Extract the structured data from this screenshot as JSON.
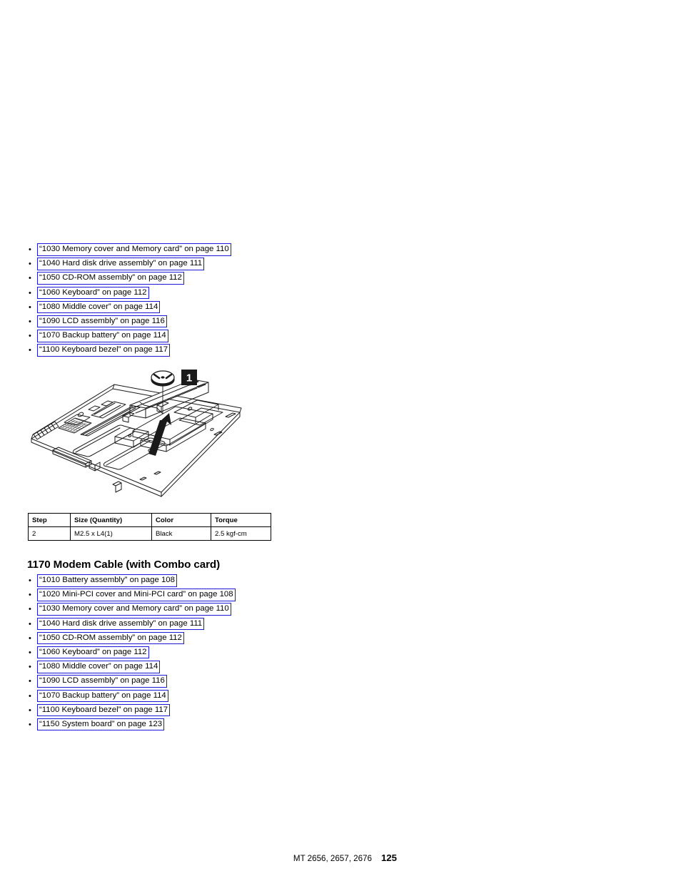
{
  "document": {
    "page_number": "125",
    "footer_machine_types": "MT 2656, 2657, 2676"
  },
  "first_list": {
    "bullet_glyph": "•",
    "items": [
      {
        "label": "“1030 Memory cover and Memory card” on page 110"
      },
      {
        "label": "“1040 Hard disk drive assembly” on page 111"
      },
      {
        "label": "“1050 CD-ROM assembly” on page 112"
      },
      {
        "label": "“1060 Keyboard” on page 112"
      },
      {
        "label": "“1080 Middle cover” on page 114"
      },
      {
        "label": "“1090 LCD assembly” on page 116"
      },
      {
        "label": "“1070 Backup battery” on page 114"
      },
      {
        "label": "“1100 Keyboard bezel” on page 117"
      }
    ]
  },
  "figure": {
    "callout_number": "1",
    "alt": "Exploded isometric view of notebook base cover with modem cable removal arrow"
  },
  "torque_table": {
    "headers": [
      "Step",
      "Size (Quantity)",
      "Color",
      "Torque"
    ],
    "rows": [
      [
        "2",
        "M2.5 x L4(1)",
        "Black",
        "2.5 kgf-cm"
      ]
    ]
  },
  "section": {
    "heading": "1170 Modem Cable (with Combo card)"
  },
  "second_list": {
    "bullet_glyph": "•",
    "items": [
      {
        "label": "“1010 Battery assembly” on page 108"
      },
      {
        "label": "“1020 Mini-PCI cover and Mini-PCI card” on page 108"
      },
      {
        "label": "“1030 Memory cover and Memory card” on page 110"
      },
      {
        "label": "“1040 Hard disk drive assembly” on page 111"
      },
      {
        "label": "“1050 CD-ROM assembly” on page 112"
      },
      {
        "label": "“1060 Keyboard” on page 112"
      },
      {
        "label": "“1080 Middle cover” on page 114"
      },
      {
        "label": "“1090 LCD assembly” on page 116"
      },
      {
        "label": "“1070 Backup battery” on page 114"
      },
      {
        "label": "“1100 Keyboard bezel” on page 117"
      },
      {
        "label": "“1150 System board” on page 123"
      }
    ]
  },
  "colors": {
    "link_border": "#1a19d6",
    "text": "#000000",
    "callout_bg": "#1a1a1a"
  }
}
